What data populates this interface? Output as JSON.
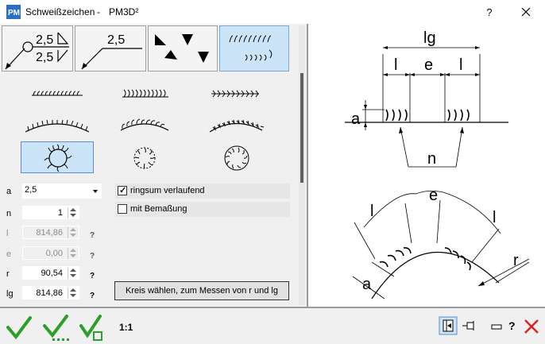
{
  "window": {
    "title": "Schweißzeichen",
    "separator": "-",
    "subtitle": "PM3D²",
    "help_label": "?",
    "logo_text": "PM"
  },
  "tabs": [
    {
      "name": "tab-double-weld-symbol",
      "value_top": "2,5",
      "value_bottom": "2,5"
    },
    {
      "name": "tab-single-weld-symbol",
      "value_top": "2,5"
    },
    {
      "name": "tab-fillet-triangles"
    },
    {
      "name": "tab-seam-patterns",
      "selected": true
    }
  ],
  "symbols": [
    {
      "name": "seam-straight-plain",
      "selected": false
    },
    {
      "name": "seam-straight-loops",
      "selected": false
    },
    {
      "name": "seam-straight-arrows",
      "selected": false
    },
    {
      "name": "seam-convex-plain",
      "selected": false
    },
    {
      "name": "seam-convex-loops",
      "selected": false
    },
    {
      "name": "seam-convex-arrows",
      "selected": false
    },
    {
      "name": "seam-circle-outward",
      "selected": true
    },
    {
      "name": "seam-circle-inward",
      "selected": false
    },
    {
      "name": "seam-circle-loops",
      "selected": false
    }
  ],
  "fields": {
    "a": {
      "label": "a",
      "value": "2,5"
    },
    "n": {
      "label": "n",
      "value": "1"
    },
    "l": {
      "label": "l",
      "value": "814,86",
      "disabled": true,
      "help": "?"
    },
    "e": {
      "label": "e",
      "value": "0,00",
      "disabled": true,
      "help": "?"
    },
    "r": {
      "label": "r",
      "value": "90,54",
      "help": "?"
    },
    "lg": {
      "label": "lg",
      "value": "814,86",
      "help": "?"
    }
  },
  "options": {
    "ringsum_label": "ringsum verlaufend",
    "ringsum_checked": true,
    "bemassung_label": "mit Bemaßung",
    "bemassung_checked": false
  },
  "measure_button_label": "Kreis wählen, zum Messen von r und lg",
  "diagram": {
    "labels": {
      "lg": "lg",
      "l_left": "l",
      "e": "e",
      "l_right": "l",
      "a": "a",
      "n": "n",
      "r": "r",
      "e_arc": "e",
      "l_arc_left": "l",
      "l_arc_right": "l",
      "a_arc": "a"
    }
  },
  "bottom": {
    "scale_label": "1:1",
    "ok_icon": "checkmark-icon",
    "apply_icon": "checkmark-dotted-icon",
    "apply_keep_icon": "checkmark-box-icon"
  },
  "colors": {
    "accent_green": "#2aa02a",
    "selection_blue": "#cce4f7",
    "close_red": "#e02020"
  }
}
